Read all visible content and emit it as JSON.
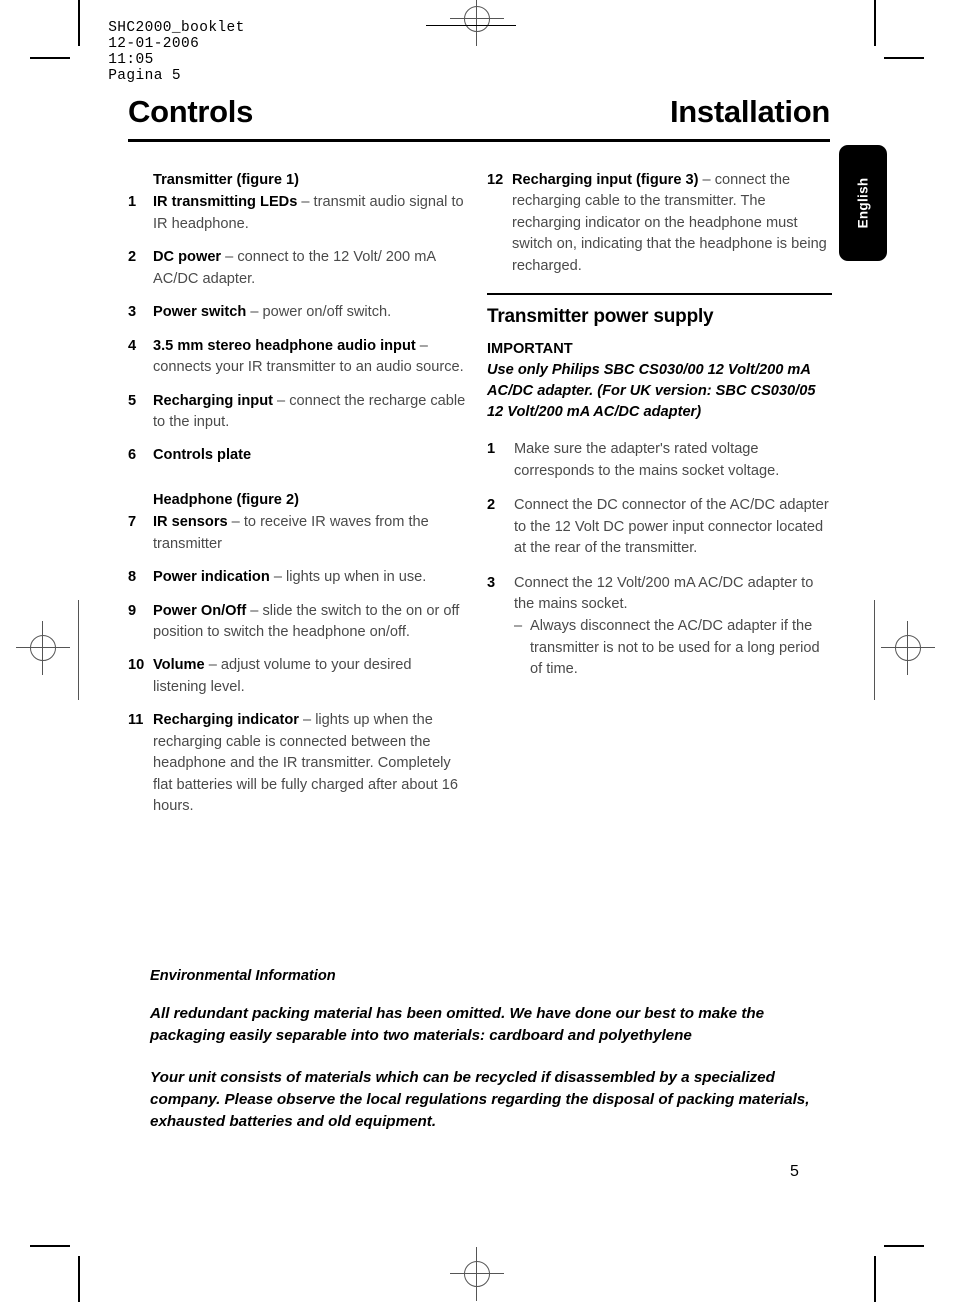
{
  "file_header": {
    "document": "SHC2000_booklet",
    "date": "12-01-2006",
    "time": "11:05",
    "page_label": "Pagina 5"
  },
  "titles": {
    "left": "Controls",
    "right": "Installation"
  },
  "language_tab": {
    "label": "English"
  },
  "left_column": {
    "transmitter_heading": "Transmitter (figure 1)",
    "headphone_heading": "Headphone (figure 2)",
    "items": [
      {
        "num": "1",
        "bold": "IR transmitting LEDs",
        "rest": " – transmit audio signal to IR headphone."
      },
      {
        "num": "2",
        "bold": "DC power",
        "rest": " – connect to the 12 Volt/ 200 mA AC/DC adapter."
      },
      {
        "num": "3",
        "bold": "Power switch",
        "rest": " – power on/off switch."
      },
      {
        "num": "4",
        "bold": "3.5 mm stereo headphone audio input",
        "rest": " – connects your IR transmitter to an audio source."
      },
      {
        "num": "5",
        "bold": "Recharging input",
        "rest": " – connect the recharge cable to the input."
      },
      {
        "num": "6",
        "bold": "Controls plate",
        "rest": ""
      },
      {
        "num": "7",
        "bold": "IR sensors",
        "rest": " – to receive IR waves from the transmitter"
      },
      {
        "num": "8",
        "bold": "Power indication",
        "rest": " – lights up when in use."
      },
      {
        "num": "9",
        "bold": "Power On/Off",
        "rest": " – slide the switch to the on or off position to switch the headphone on/off."
      },
      {
        "num": "10",
        "bold": "Volume",
        "rest": " – adjust volume to your desired listening level."
      },
      {
        "num": "11",
        "bold": "Recharging indicator",
        "rest": " – lights up when the recharging cable is connected between the headphone and the IR transmitter. Completely flat batteries will be fully charged after about 16 hours."
      }
    ]
  },
  "right_column": {
    "item12": {
      "num": "12",
      "bold": "Recharging input (figure 3)",
      "rest": " – connect the recharging cable to the transmitter. The recharging indicator on the headphone must switch on, indicating that the headphone is being recharged."
    },
    "section_title": "Transmitter power supply",
    "important_title": "IMPORTANT",
    "important_body": "Use only Philips SBC CS030/00 12 Volt/200 mA AC/DC adapter. (For UK version: SBC CS030/05 12 Volt/200 mA AC/DC adapter)",
    "steps": [
      {
        "num": "1",
        "text": "Make sure the adapter's rated voltage corresponds to the mains socket voltage."
      },
      {
        "num": "2",
        "text": "Connect the DC connector of the AC/DC adapter to the 12 Volt DC power input connector located at the rear of the transmitter."
      },
      {
        "num": "3",
        "text": "Connect the 12 Volt/200 mA AC/DC adapter to the mains socket.",
        "sub_dash": "–",
        "sub_text": "Always disconnect the AC/DC adapter if the transmitter is not to be used for a long period of time."
      }
    ]
  },
  "environmental": {
    "title": "Environmental Information",
    "paragraph1": "All redundant packing material has been omitted. We have done our best to make the packaging easily separable into two materials: cardboard and polyethylene",
    "paragraph2": "Your unit consists of materials which can be recycled if disassembled by a specialized company. Please observe the local regulations regarding the disposal of packing materials, exhausted batteries and old equipment."
  },
  "page_number": "5"
}
